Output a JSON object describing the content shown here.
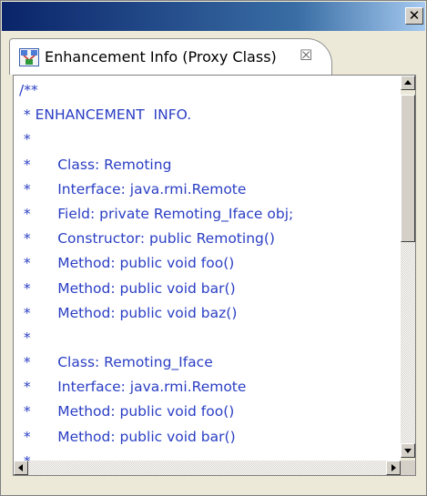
{
  "window": {
    "close_glyph": "✕"
  },
  "tab": {
    "title": "Enhancement Info (Proxy Class)",
    "close_glyph": "☒",
    "icon": "class-diagram-icon"
  },
  "code": {
    "lines": [
      "/**",
      " * ENHANCEMENT  INFO.",
      " *",
      " *      Class: Remoting",
      " *      Interface: java.rmi.Remote",
      " *      Field: private Remoting_Iface obj;",
      " *      Constructor: public Remoting()",
      " *      Method: public void foo()",
      " *      Method: public void bar()",
      " *      Method: public void baz()",
      " *",
      " *      Class: Remoting_Iface",
      " *      Interface: java.rmi.Remote",
      " *      Method: public void foo()",
      " *      Method: public void bar()",
      " *"
    ],
    "text_color": "#2a3ec4"
  },
  "colors": {
    "titlebar_start": "#0a246a",
    "titlebar_end": "#a6caf0",
    "panel_bg": "#ece9d8"
  }
}
